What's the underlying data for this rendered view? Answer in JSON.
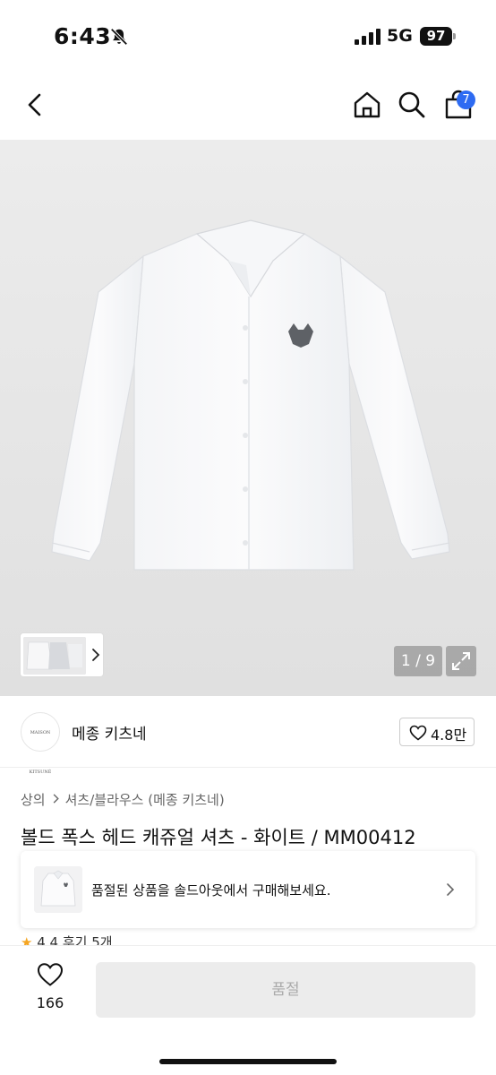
{
  "status_bar": {
    "time": "6:43",
    "network": "5G",
    "battery": "97"
  },
  "nav": {
    "cart_count": "7"
  },
  "gallery": {
    "counter": "1 / 9"
  },
  "brand": {
    "logo_text": "MAISON KITSUNÉ",
    "name": "메종 키츠네",
    "likes": "4.8만"
  },
  "breadcrumb": {
    "level1": "상의",
    "level2": "셔츠/블라우스 (메종 키츠네)"
  },
  "product": {
    "title": "볼드 폭스 헤드 캐쥬얼 셔츠 - 화이트 / MM00412"
  },
  "soldout_banner": {
    "text": "품절된 상품을 솔드아웃에서 구매해보세요."
  },
  "rating": {
    "star": "★",
    "score": "4.4",
    "reviews": "후기 5개"
  },
  "bottom_bar": {
    "wishlist_count": "166",
    "buy_label": "품절"
  },
  "colors": {
    "accent": "#2e6bf2",
    "rating_star": "#f5a623",
    "disabled_button": "#ececec"
  }
}
